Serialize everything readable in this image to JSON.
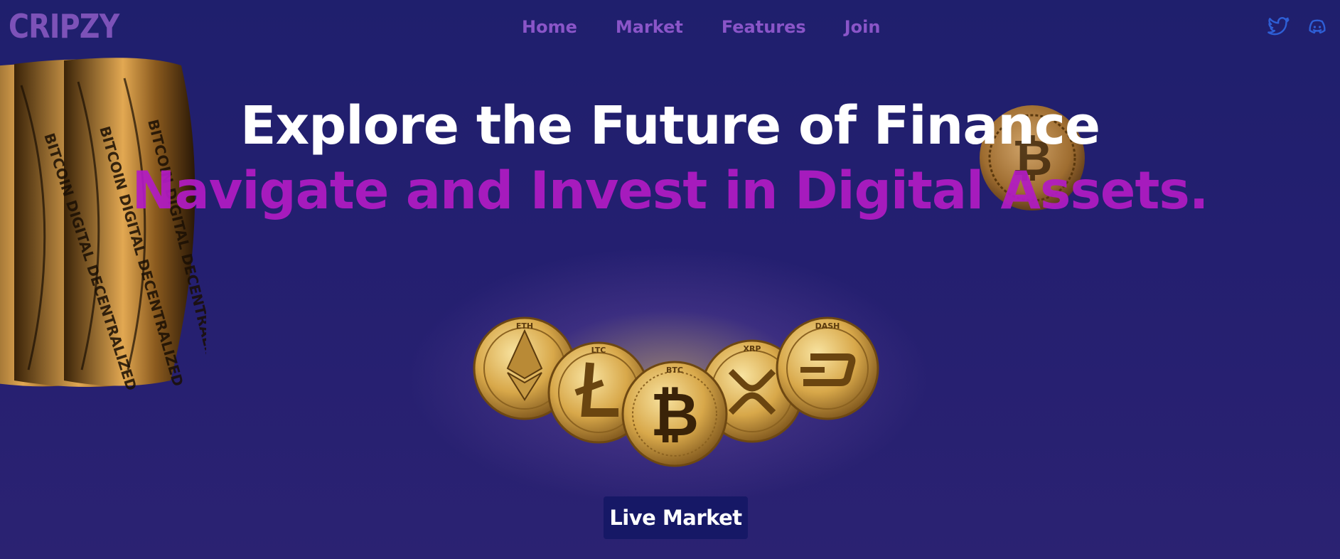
{
  "brand": {
    "logo_text": "CRIPZY"
  },
  "nav": {
    "links": [
      {
        "label": "Home"
      },
      {
        "label": "Market"
      },
      {
        "label": "Features"
      },
      {
        "label": "Join"
      }
    ]
  },
  "social": [
    {
      "icon": "twitter-icon"
    },
    {
      "icon": "discord-icon"
    }
  ],
  "hero": {
    "headline": "Explore the Future of Finance",
    "subheadline": "Navigate and Invest in Digital Assets."
  },
  "cta": {
    "label": "Live Market"
  },
  "coin_stack_text": "BITCOIN DIGITAL DECENTRALIZED",
  "coins": [
    "ETH",
    "LTC",
    "BTC",
    "XRP",
    "DASH"
  ],
  "colors": {
    "background": "#1f1f6d",
    "logo": "#7d52b8",
    "nav_link": "#8a55c8",
    "headline": "#ffffff",
    "subheadline": "#b21bc4",
    "social_icon": "#2e5fd6",
    "cta_bg": "#161866",
    "coin_gold": "#d8a84a"
  }
}
